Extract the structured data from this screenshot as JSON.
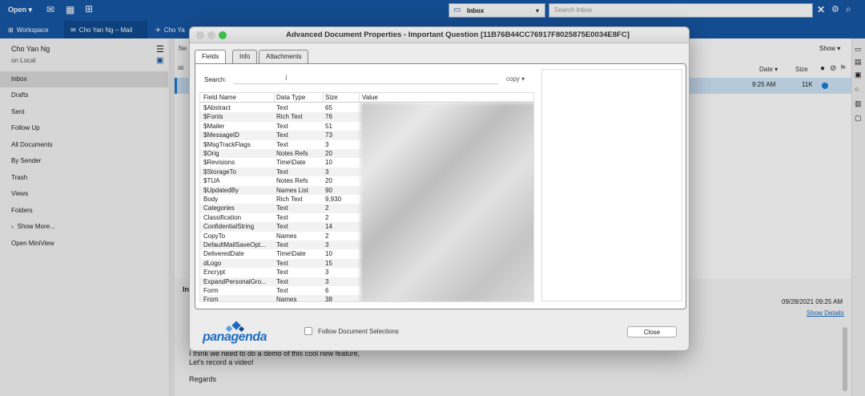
{
  "topbar": {
    "open_label": "Open",
    "inbox_select": "Inbox",
    "search_placeholder": "Search Inbox"
  },
  "tabs": [
    {
      "label": "Workspace"
    },
    {
      "label": "Cho Yan Ng – Mail"
    },
    {
      "label": "Cho Ya"
    }
  ],
  "sidebar": {
    "user_name": "Cho Yan Ng",
    "location": "on Local",
    "items": [
      "Inbox",
      "Drafts",
      "Sent",
      "Follow Up",
      "All Documents",
      "By Sender",
      "Trash",
      "Views",
      "Folders",
      "Show More...",
      "Open MiniView"
    ]
  },
  "maillist": {
    "show_label": "Show",
    "col_date": "Date",
    "col_size": "Size",
    "selected_row": {
      "time": "9:25 AM",
      "size": "11K"
    }
  },
  "readpane": {
    "date": "09/28/2021 09:25 AM",
    "show_details": "Show Details",
    "body_line1": "I think we need to do a demo of this cool new feature,",
    "body_line2": "Let's record a video!",
    "regards": "Regards",
    "partial_label": "In"
  },
  "dialog": {
    "title": "Advanced Document Properties - Important Question [11B76B44CC76917F8025875E0034E8FC]",
    "tabs": [
      "Fields",
      "Info",
      "Attachments"
    ],
    "search_label": "Search:",
    "copy_label": "copy ▾",
    "columns": [
      "Field Name",
      "Data Type",
      "Size",
      "Value"
    ],
    "rows": [
      [
        "$Abstract",
        "Text",
        "65"
      ],
      [
        "$Fonts",
        "Rich Text",
        "76"
      ],
      [
        "$Mailer",
        "Text",
        "51"
      ],
      [
        "$MessageID",
        "Text",
        "73"
      ],
      [
        "$MsgTrackFlags",
        "Text",
        "3"
      ],
      [
        "$Orig",
        "Notes Refs",
        "20"
      ],
      [
        "$Revisions",
        "Time\\Date",
        "10"
      ],
      [
        "$StorageTo",
        "Text",
        "3"
      ],
      [
        "$TUA",
        "Notes Refs",
        "20"
      ],
      [
        "$UpdatedBy",
        "Names List",
        "90"
      ],
      [
        "Body",
        "Rich Text",
        "9,930"
      ],
      [
        "Categories",
        "Text",
        "2"
      ],
      [
        "Classification",
        "Text",
        "2"
      ],
      [
        "ConfidentialString",
        "Text",
        "14"
      ],
      [
        "CopyTo",
        "Names",
        "2"
      ],
      [
        "DefaultMailSaveOpt...",
        "Text",
        "3"
      ],
      [
        "DeliveredDate",
        "Time\\Date",
        "10"
      ],
      [
        "dLogo",
        "Text",
        "15"
      ],
      [
        "Encrypt",
        "Text",
        "3"
      ],
      [
        "ExpandPersonalGro...",
        "Text",
        "3"
      ],
      [
        "Form",
        "Text",
        "6"
      ],
      [
        "From",
        "Names",
        "38"
      ]
    ],
    "logo_text": "panagenda",
    "follow_label": "Follow Document Selections",
    "close_label": "Close"
  },
  "colors": {
    "brand_blue": "#1757a6",
    "accent": "#1a7dd1",
    "logo_blue": "#1a6cc4"
  }
}
